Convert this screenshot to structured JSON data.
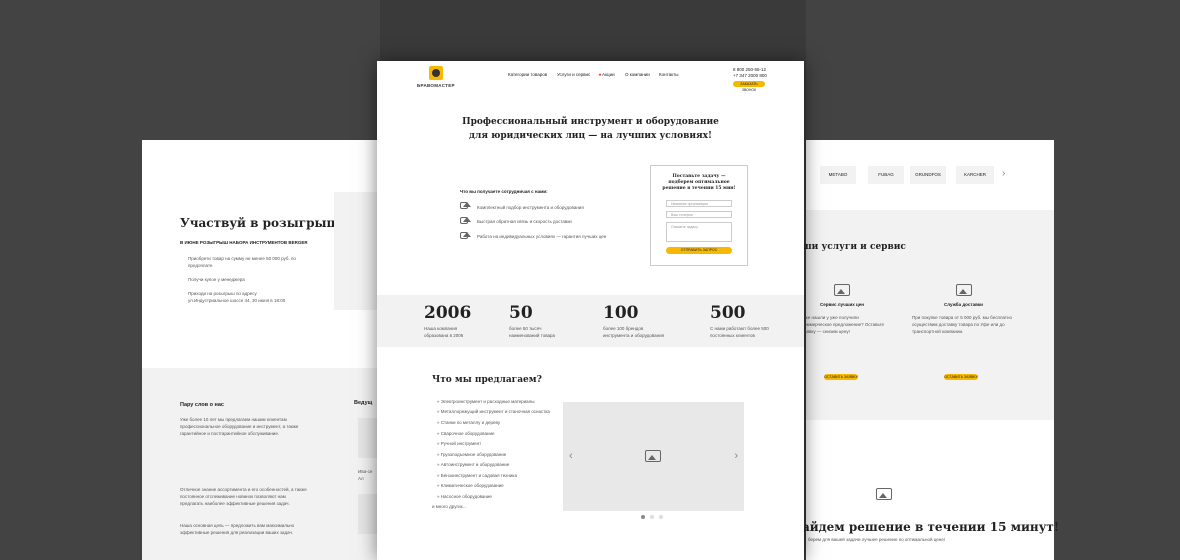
{
  "brand": {
    "name": "БРАВОМАСТЕР"
  },
  "nav": [
    "Категории товаров",
    "Услуги и сервис",
    "Акции",
    "О компании",
    "Контакты"
  ],
  "contacts": {
    "phone1": "8 800 250-55-12",
    "phone2": "+7 347 2000 800",
    "callback": "ЗАКАЗАТЬ ЗВОНОК"
  },
  "hero": {
    "title1": "Профессиональный инструмент и оборудование",
    "title2": "для юридических лиц — на лучших условиях!",
    "benefits_title": "Что вы получаете сотрудничая с нами:",
    "benefits": [
      "Комплектный подбор инструмента и оборудования",
      "Быстрая обратная связь и скорость доставки",
      "Работа на индивидуальных условиях — гарантия лучших цен"
    ],
    "form_title": "Поставьте задачу — подберем оптимальное решение в течении 15 мин!",
    "form_fields": [
      "Название организации",
      "Ваш телефон",
      "Опишите задачу"
    ],
    "form_button": "ОТПРАВИТЬ ЗАПРОС"
  },
  "stats": [
    {
      "num": "2006",
      "text": "Наша компания образована в 2006"
    },
    {
      "num": "50",
      "text": "более 50 тысяч наименований товара"
    },
    {
      "num": "100",
      "text": "более 100 брендов инструмента и оборудования"
    },
    {
      "num": "500",
      "text": "С нами работают более 500 постоянных клиентов"
    }
  ],
  "offer": {
    "title": "Что мы предлагаем?",
    "items": [
      "Электроинструмент и расходные материалы",
      "Металлорежущий инструмент и станочная оснастка",
      "Станки по металлу и дереву",
      "Сварочное оборудование",
      "Ручной инструмент",
      "Грузоподъемное оборудование",
      "Автоинструмент и оборудование",
      "Бензоинструмент и садовая техника",
      "Климатическое оборудование",
      "Насосное оборудование"
    ],
    "more": "и много других..."
  },
  "left": {
    "contest_title": "Участвуй в розыгрыше!",
    "contest_sub": "В ИЮНЕ РОЗЫГРЫШ НАБОРА ИНСТРУМЕНТОВ BERGER",
    "steps": [
      "Приобрети товар на сумму не менее 50 000 руб. по предоплате",
      "Получи купон у менеджера",
      "Приходи на розыгрыш по адресу ул.Индустриальное шоссе 44, 30 июня в 18:00"
    ],
    "about_title": "Пару слов о нас",
    "about_text": "Уже более 10 лет мы предлагаем нашим клиентам профессиональное оборудование и инструмент, а также гарантийное и постгарантийное обслуживание.",
    "leading": "Ведущ",
    "caption": "Ива-се Ал"
  },
  "right": {
    "brands": [
      "METABO",
      "FUBAG",
      "GRUNDFOS",
      "KARCHER"
    ],
    "services_title": "ши услуги и сервис",
    "services": [
      {
        "title": "Сервис лучших цен",
        "text": "Уже нашли у уже получили коммерческое предложение? Оставьте заявку — снизим цену!",
        "button": "ОСТАВИТЬ ЗАЯВКУ"
      },
      {
        "title": "Служба доставки",
        "text": "При покупке товара от 5 000 руб. мы бесплатно осуществим доставку товара по Уфе или до транспортной компании.",
        "button": "ОСТАВИТЬ ЗАЯВКУ"
      }
    ],
    "bottom_title": "айдем решение в течении 15 минут!",
    "bottom_sub": "берем для вашей задачи лучшее решение по оптимальной цене!"
  },
  "colors": {
    "accent": "#f6b800",
    "bg": "#3a3a3a"
  }
}
